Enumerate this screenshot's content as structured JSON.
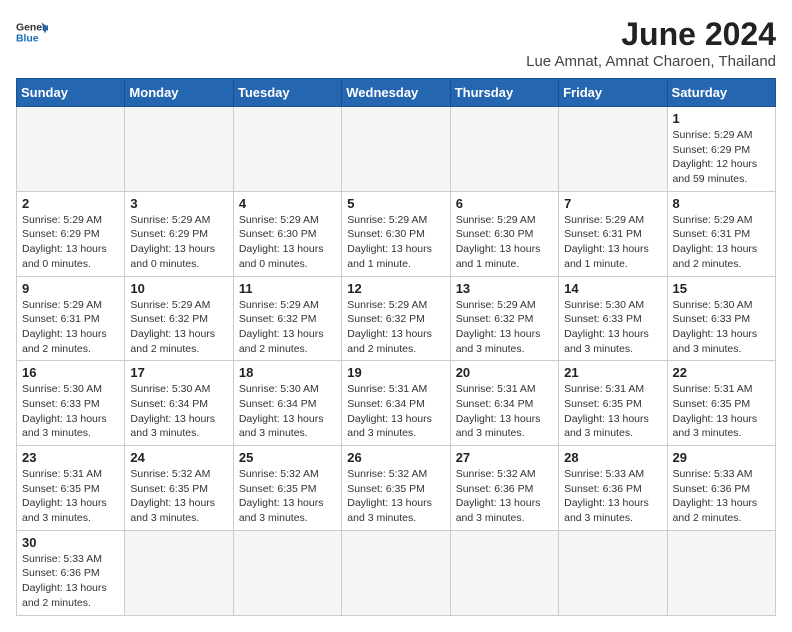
{
  "header": {
    "logo_general": "General",
    "logo_blue": "Blue",
    "title": "June 2024",
    "subtitle": "Lue Amnat, Amnat Charoen, Thailand"
  },
  "weekdays": [
    "Sunday",
    "Monday",
    "Tuesday",
    "Wednesday",
    "Thursday",
    "Friday",
    "Saturday"
  ],
  "days": [
    {
      "date": "",
      "info": ""
    },
    {
      "date": "",
      "info": ""
    },
    {
      "date": "",
      "info": ""
    },
    {
      "date": "",
      "info": ""
    },
    {
      "date": "",
      "info": ""
    },
    {
      "date": "",
      "info": ""
    },
    {
      "date": "1",
      "sunrise": "5:29 AM",
      "sunset": "6:29 PM",
      "daylight": "12 hours and 59 minutes."
    },
    {
      "date": "2",
      "sunrise": "5:29 AM",
      "sunset": "6:29 PM",
      "daylight": "13 hours and 0 minutes."
    },
    {
      "date": "3",
      "sunrise": "5:29 AM",
      "sunset": "6:29 PM",
      "daylight": "13 hours and 0 minutes."
    },
    {
      "date": "4",
      "sunrise": "5:29 AM",
      "sunset": "6:30 PM",
      "daylight": "13 hours and 0 minutes."
    },
    {
      "date": "5",
      "sunrise": "5:29 AM",
      "sunset": "6:30 PM",
      "daylight": "13 hours and 1 minute."
    },
    {
      "date": "6",
      "sunrise": "5:29 AM",
      "sunset": "6:30 PM",
      "daylight": "13 hours and 1 minute."
    },
    {
      "date": "7",
      "sunrise": "5:29 AM",
      "sunset": "6:31 PM",
      "daylight": "13 hours and 1 minute."
    },
    {
      "date": "8",
      "sunrise": "5:29 AM",
      "sunset": "6:31 PM",
      "daylight": "13 hours and 2 minutes."
    },
    {
      "date": "9",
      "sunrise": "5:29 AM",
      "sunset": "6:31 PM",
      "daylight": "13 hours and 2 minutes."
    },
    {
      "date": "10",
      "sunrise": "5:29 AM",
      "sunset": "6:32 PM",
      "daylight": "13 hours and 2 minutes."
    },
    {
      "date": "11",
      "sunrise": "5:29 AM",
      "sunset": "6:32 PM",
      "daylight": "13 hours and 2 minutes."
    },
    {
      "date": "12",
      "sunrise": "5:29 AM",
      "sunset": "6:32 PM",
      "daylight": "13 hours and 2 minutes."
    },
    {
      "date": "13",
      "sunrise": "5:29 AM",
      "sunset": "6:32 PM",
      "daylight": "13 hours and 3 minutes."
    },
    {
      "date": "14",
      "sunrise": "5:30 AM",
      "sunset": "6:33 PM",
      "daylight": "13 hours and 3 minutes."
    },
    {
      "date": "15",
      "sunrise": "5:30 AM",
      "sunset": "6:33 PM",
      "daylight": "13 hours and 3 minutes."
    },
    {
      "date": "16",
      "sunrise": "5:30 AM",
      "sunset": "6:33 PM",
      "daylight": "13 hours and 3 minutes."
    },
    {
      "date": "17",
      "sunrise": "5:30 AM",
      "sunset": "6:34 PM",
      "daylight": "13 hours and 3 minutes."
    },
    {
      "date": "18",
      "sunrise": "5:30 AM",
      "sunset": "6:34 PM",
      "daylight": "13 hours and 3 minutes."
    },
    {
      "date": "19",
      "sunrise": "5:31 AM",
      "sunset": "6:34 PM",
      "daylight": "13 hours and 3 minutes."
    },
    {
      "date": "20",
      "sunrise": "5:31 AM",
      "sunset": "6:34 PM",
      "daylight": "13 hours and 3 minutes."
    },
    {
      "date": "21",
      "sunrise": "5:31 AM",
      "sunset": "6:35 PM",
      "daylight": "13 hours and 3 minutes."
    },
    {
      "date": "22",
      "sunrise": "5:31 AM",
      "sunset": "6:35 PM",
      "daylight": "13 hours and 3 minutes."
    },
    {
      "date": "23",
      "sunrise": "5:31 AM",
      "sunset": "6:35 PM",
      "daylight": "13 hours and 3 minutes."
    },
    {
      "date": "24",
      "sunrise": "5:32 AM",
      "sunset": "6:35 PM",
      "daylight": "13 hours and 3 minutes."
    },
    {
      "date": "25",
      "sunrise": "5:32 AM",
      "sunset": "6:35 PM",
      "daylight": "13 hours and 3 minutes."
    },
    {
      "date": "26",
      "sunrise": "5:32 AM",
      "sunset": "6:35 PM",
      "daylight": "13 hours and 3 minutes."
    },
    {
      "date": "27",
      "sunrise": "5:32 AM",
      "sunset": "6:36 PM",
      "daylight": "13 hours and 3 minutes."
    },
    {
      "date": "28",
      "sunrise": "5:33 AM",
      "sunset": "6:36 PM",
      "daylight": "13 hours and 3 minutes."
    },
    {
      "date": "29",
      "sunrise": "5:33 AM",
      "sunset": "6:36 PM",
      "daylight": "13 hours and 2 minutes."
    },
    {
      "date": "30",
      "sunrise": "5:33 AM",
      "sunset": "6:36 PM",
      "daylight": "13 hours and 2 minutes."
    }
  ],
  "labels": {
    "sunrise": "Sunrise:",
    "sunset": "Sunset:",
    "daylight": "Daylight:"
  }
}
